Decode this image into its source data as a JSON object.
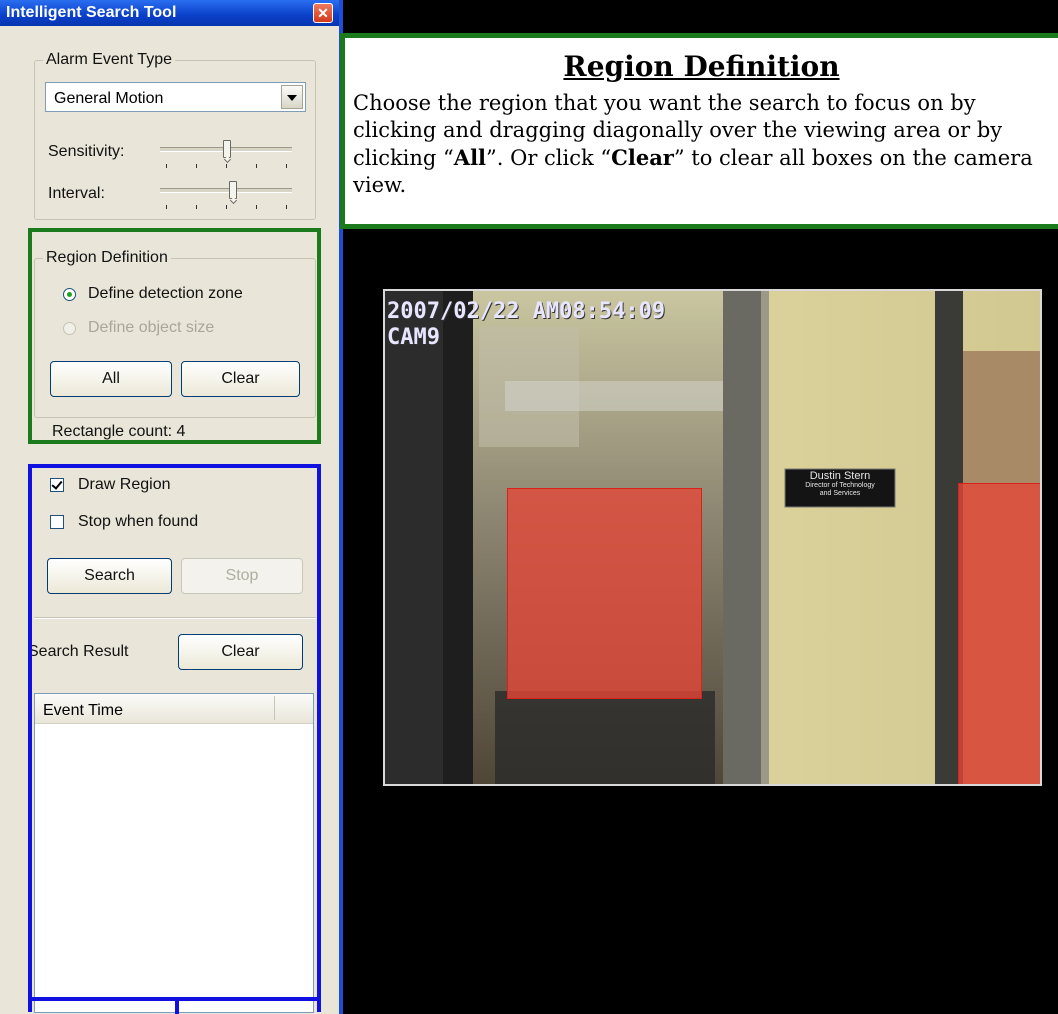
{
  "window": {
    "title": "Intelligent Search Tool",
    "close_icon": "close-icon"
  },
  "alarm": {
    "legend": "Alarm Event Type",
    "selected": "General Motion",
    "sensitivity_label": "Sensitivity:",
    "sensitivity_level": 0.5,
    "interval_label": "Interval:",
    "interval_level": 0.55
  },
  "region": {
    "legend": "Region Definition",
    "option_zone": "Define detection zone",
    "option_zone_selected": true,
    "option_size": "Define object size",
    "option_size_enabled": false,
    "all_button": "All",
    "clear_button": "Clear",
    "rect_count": "Rectangle count: 4"
  },
  "search": {
    "draw_region": "Draw Region",
    "draw_region_checked": true,
    "stop_when_found": "Stop when found",
    "stop_when_found_checked": false,
    "search_button": "Search",
    "stop_button": "Stop",
    "result_label": "Search Result",
    "clear_button": "Clear",
    "column_event_time": "Event Time"
  },
  "callout": {
    "title": "Region Definition",
    "text_1": "Choose the region that you want the search to focus on by clicking and dragging diagonally over the viewing area or by clicking “",
    "text_all": "All",
    "text_2": "”. Or click “",
    "text_clear": "Clear",
    "text_3": "” to clear all boxes on the camera view."
  },
  "camera": {
    "timestamp": "2007/02/22 AM08:54:09",
    "channel": "CAM9",
    "sign_name": "Dustin Stern",
    "sign_title_1": "Director of Technology",
    "sign_title_2": "and Services"
  },
  "colors": {
    "callout_border": "#1b7a1b",
    "region_highlight": "#1b7a1b",
    "search_highlight": "#1010e0",
    "zone_fill": "#e64637"
  }
}
